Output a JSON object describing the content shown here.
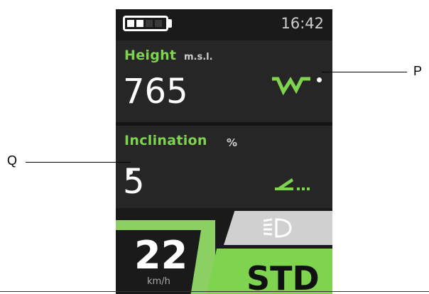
{
  "status": {
    "time": "16:42",
    "battery_icon": "battery-icon",
    "battery_level": 0.5
  },
  "height_panel": {
    "label": "Height",
    "unit": "m.s.l.",
    "value": "765",
    "icon": "mountain-icon",
    "accent": "#7ed34f"
  },
  "inclination_panel": {
    "label": "Inclination",
    "unit": "%",
    "value": "5",
    "icon": "incline-icon"
  },
  "speed": {
    "value": "22",
    "unit": "km/h"
  },
  "light": {
    "icon": "headlight-icon"
  },
  "mode": {
    "label": "STD"
  },
  "callouts": {
    "p": "P",
    "q": "Q"
  },
  "colors": {
    "accent": "#7ed34f",
    "screen_bg": "#1a1a1a",
    "panel_bg": "#262626"
  }
}
